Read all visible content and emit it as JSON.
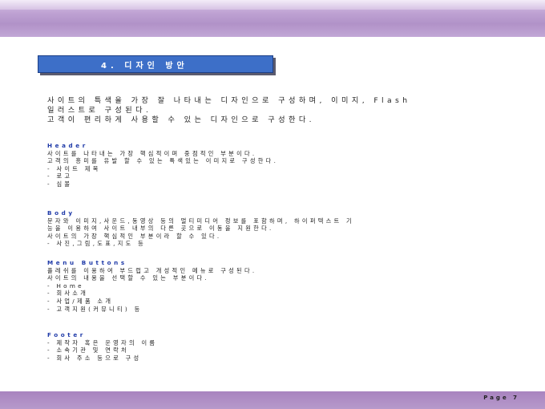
{
  "section_title": "4. 디자인 방안",
  "intro": [
    "사이트의 특색을 가장 잘 나타내는 디자인으로 구성하며, 이미지, Flash",
    "일러스트로 구성된다.",
    "고객이 편리하게 사용할 수 있는 디자인으로 구성한다."
  ],
  "sections": [
    {
      "heading": "Header",
      "lines": [
        "사이트를 나타내는 가장 핵심적이며 중점적인 부분이다.",
        "고객의 흥미를 유발 할 수 있는 특색있는 이미지로 구성한다.",
        "- 사이트 제목",
        "- 로고",
        "- 심볼"
      ]
    },
    {
      "heading": "Body",
      "lines": [
        "문자와 이미지,사운드,동영상 등의 멀티미디어 정보를 포함하며, 하이퍼텍스트 기",
        "능을 이용하여 사이트 내부의 다른 곳으로 이동을 지원한다.",
        "사이트의 가장 핵심적인 부분이라 할 수 있다.",
        "- 사진,그림,도표,지도 등"
      ]
    },
    {
      "heading": "Menu Buttons",
      "lines": [
        "플레쉬를 이용하여 부드럽고 개성적인 메뉴로 구성된다.",
        "사이트의 내용을 선택할 수 있는 부분이다.",
        "- Home",
        "- 회사소개",
        "- 사업/제품 소개",
        "- 고객지원(커뮤니티) 등"
      ]
    },
    {
      "heading": "Footer",
      "lines": [
        "- 제작자 혹은 운영자의 이름",
        "- 소속기관 및 연락처",
        "- 회사 주소 등으로 구성"
      ]
    }
  ],
  "footer": {
    "page_label": "Page 7"
  },
  "colors": {
    "band": "#b192c8",
    "title_box": "#3d6fc8",
    "heading": "#1f3aa8"
  }
}
